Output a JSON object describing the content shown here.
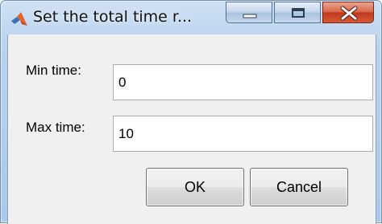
{
  "window": {
    "title": "Set the total time r...",
    "icon": "matlab-icon",
    "controls": {
      "minimize": "minimize-icon",
      "maximize": "maximize-icon",
      "close": "close-icon"
    }
  },
  "form": {
    "min_time": {
      "label": "Min time:",
      "value": "0"
    },
    "max_time": {
      "label": "Max time:",
      "value": "10"
    }
  },
  "buttons": {
    "ok": "OK",
    "cancel": "Cancel"
  },
  "colors": {
    "titlebar": "#b9d2ee",
    "client_background": "#f0f0f0",
    "close_button": "#c1391c"
  }
}
